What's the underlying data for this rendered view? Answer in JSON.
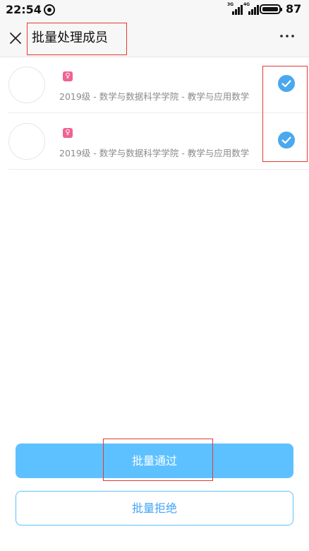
{
  "status_bar": {
    "time": "22:54",
    "signal_1_label": "3G",
    "signal_2_label": "4G",
    "battery": "87"
  },
  "header": {
    "title": "批量处理成员",
    "close_icon": "close-icon",
    "more_icon": "more-icon"
  },
  "members": [
    {
      "gender_icon": "♀",
      "info": "2019级 - 数学与数据科学学院 - 教学与应用数学",
      "checked": true
    },
    {
      "gender_icon": "♀",
      "info": "2019级 - 数学与数据科学学院 - 教学与应用数学",
      "checked": true
    }
  ],
  "actions": {
    "approve_label": "批量通过",
    "reject_label": "批量拒绝"
  },
  "colors": {
    "accent": "#5ec1ff",
    "check": "#4aa8ee",
    "female": "#f06292",
    "highlight_box": "#e53935"
  }
}
